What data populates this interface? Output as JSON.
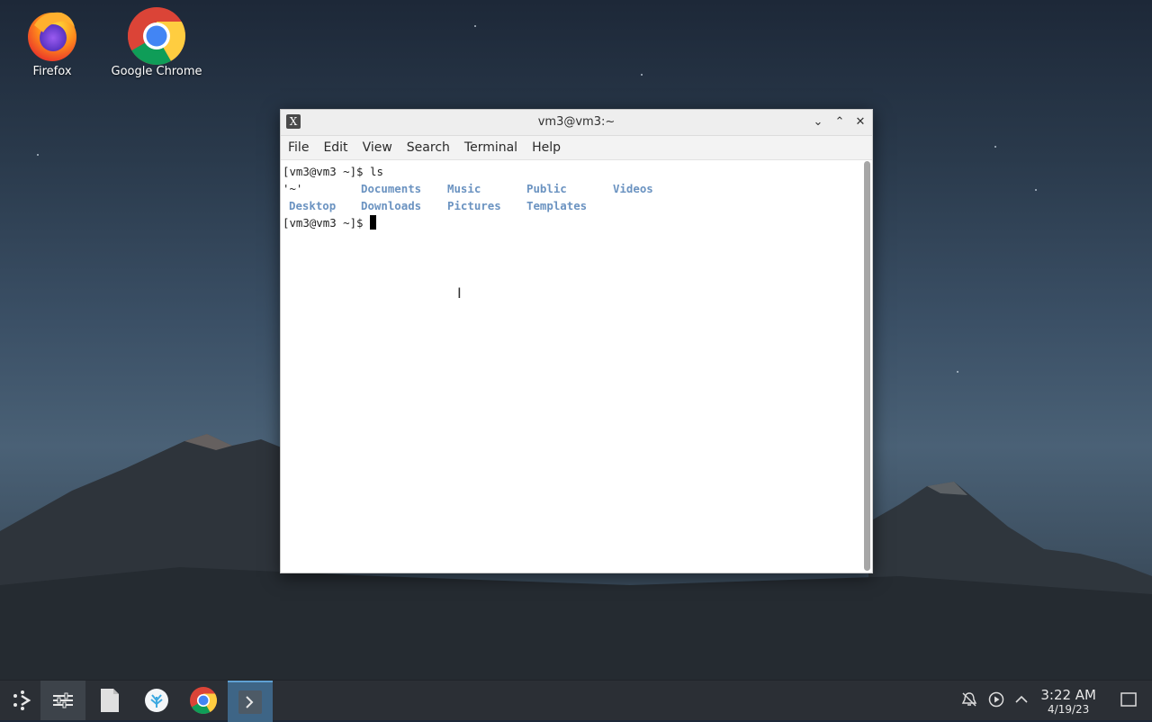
{
  "desktop": {
    "icons": [
      {
        "label": "Firefox"
      },
      {
        "label": "Google Chrome"
      }
    ]
  },
  "window": {
    "title": "vm3@vm3:~",
    "menu": [
      "File",
      "Edit",
      "View",
      "Search",
      "Terminal",
      "Help"
    ]
  },
  "terminal": {
    "prompt": "[vm3@vm3 ~]$ ",
    "command": "ls",
    "row1": [
      "'~'",
      "Documents",
      "Music",
      "Public",
      "Videos"
    ],
    "row2": [
      "Desktop",
      "Downloads",
      "Pictures",
      "Templates"
    ]
  },
  "taskbar": {
    "time": "3:22 AM",
    "date": "4/19/23"
  },
  "colors": {
    "directory": "#6b93c1",
    "taskbar": "#2b2f35",
    "active_task": "#3e6586"
  }
}
